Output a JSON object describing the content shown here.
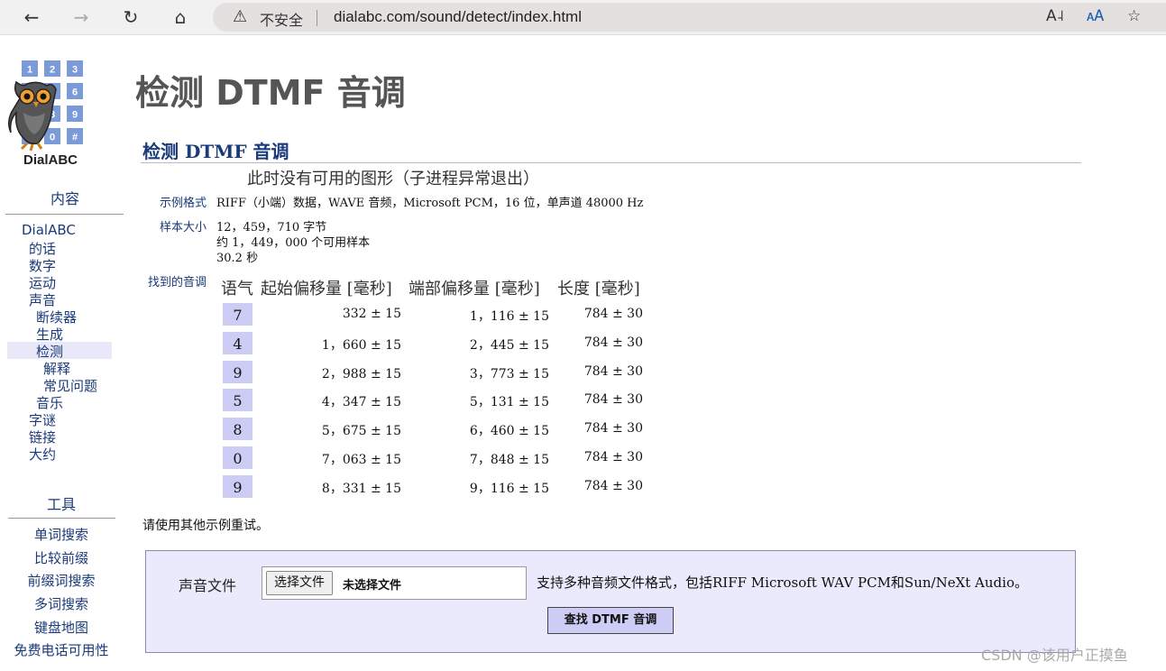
{
  "browser": {
    "security_label": "不安全",
    "url": "dialabc.com/sound/detect/index.html"
  },
  "sidebar": {
    "logo_text": "DialABC",
    "keypad_keys": [
      "1",
      "2",
      "3",
      "4",
      "5",
      "6",
      "7",
      "8",
      "9",
      "*",
      "0",
      "#"
    ],
    "contents_heading": "内容",
    "contents": [
      {
        "label": "DialABC"
      },
      {
        "label": "的话"
      },
      {
        "label": "数字"
      },
      {
        "label": "运动"
      },
      {
        "label": "声音"
      },
      {
        "label": "断续器"
      },
      {
        "label": "生成"
      },
      {
        "label": "检测"
      },
      {
        "label": "解释"
      },
      {
        "label": "常见问题"
      },
      {
        "label": "音乐"
      },
      {
        "label": "字谜"
      },
      {
        "label": "链接"
      },
      {
        "label": "大约"
      }
    ],
    "tools_heading": "工具",
    "tools": [
      {
        "label": "单词搜索"
      },
      {
        "label": "比较前缀"
      },
      {
        "label": "前缀词搜索"
      },
      {
        "label": "多词搜索"
      },
      {
        "label": "键盘地图"
      },
      {
        "label": "免费电话可用性"
      }
    ]
  },
  "main": {
    "page_title": "检测 DTMF 音调",
    "section_title": "检测 DTMF 音调",
    "no_graph": "此时没有可用的图形（子进程异常退出）",
    "format_label": "示例格式",
    "format_value": "RIFF（小端）数据，WAVE 音频，Microsoft PCM，16 位，单声道 48000 Hz",
    "size_label": "样本大小",
    "size_bytes": "12，459，710 字节",
    "size_samples": "约 1，449，000 个可用样本",
    "size_seconds": "30.2 秒",
    "tones_label": "找到的音调",
    "table_header": [
      "语气",
      "起始偏移量 [毫秒]",
      "端部偏移量 [毫秒]",
      "长度 [毫秒]"
    ],
    "rows": [
      {
        "tone": "7",
        "start": "332 ± 15",
        "end": "1，116 ± 15",
        "length": "784 ± 30"
      },
      {
        "tone": "4",
        "start": "1，660 ± 15",
        "end": "2，445 ± 15",
        "length": "784 ± 30"
      },
      {
        "tone": "9",
        "start": "2，988 ± 15",
        "end": "3，773 ± 15",
        "length": "784 ± 30"
      },
      {
        "tone": "5",
        "start": "4，347 ± 15",
        "end": "5，131 ± 15",
        "length": "784 ± 30"
      },
      {
        "tone": "8",
        "start": "5，675 ± 15",
        "end": "6，460 ± 15",
        "length": "784 ± 30"
      },
      {
        "tone": "0",
        "start": "7，063 ± 15",
        "end": "7，848 ± 15",
        "length": "784 ± 30"
      },
      {
        "tone": "9",
        "start": "8，331 ± 15",
        "end": "9，116 ± 15",
        "length": "784 ± 30"
      }
    ],
    "retry_text": "请使用其他示例重试。",
    "form": {
      "label": "声音文件",
      "choose_button": "选择文件",
      "no_file": "未选择文件",
      "note": "支持多种音频文件格式，包括RIFF Microsoft WAV PCM和Sun/NeXt Audio。",
      "submit": "查找 DTMF 音调"
    }
  },
  "watermark": "CSDN @该用户正摸鱼"
}
